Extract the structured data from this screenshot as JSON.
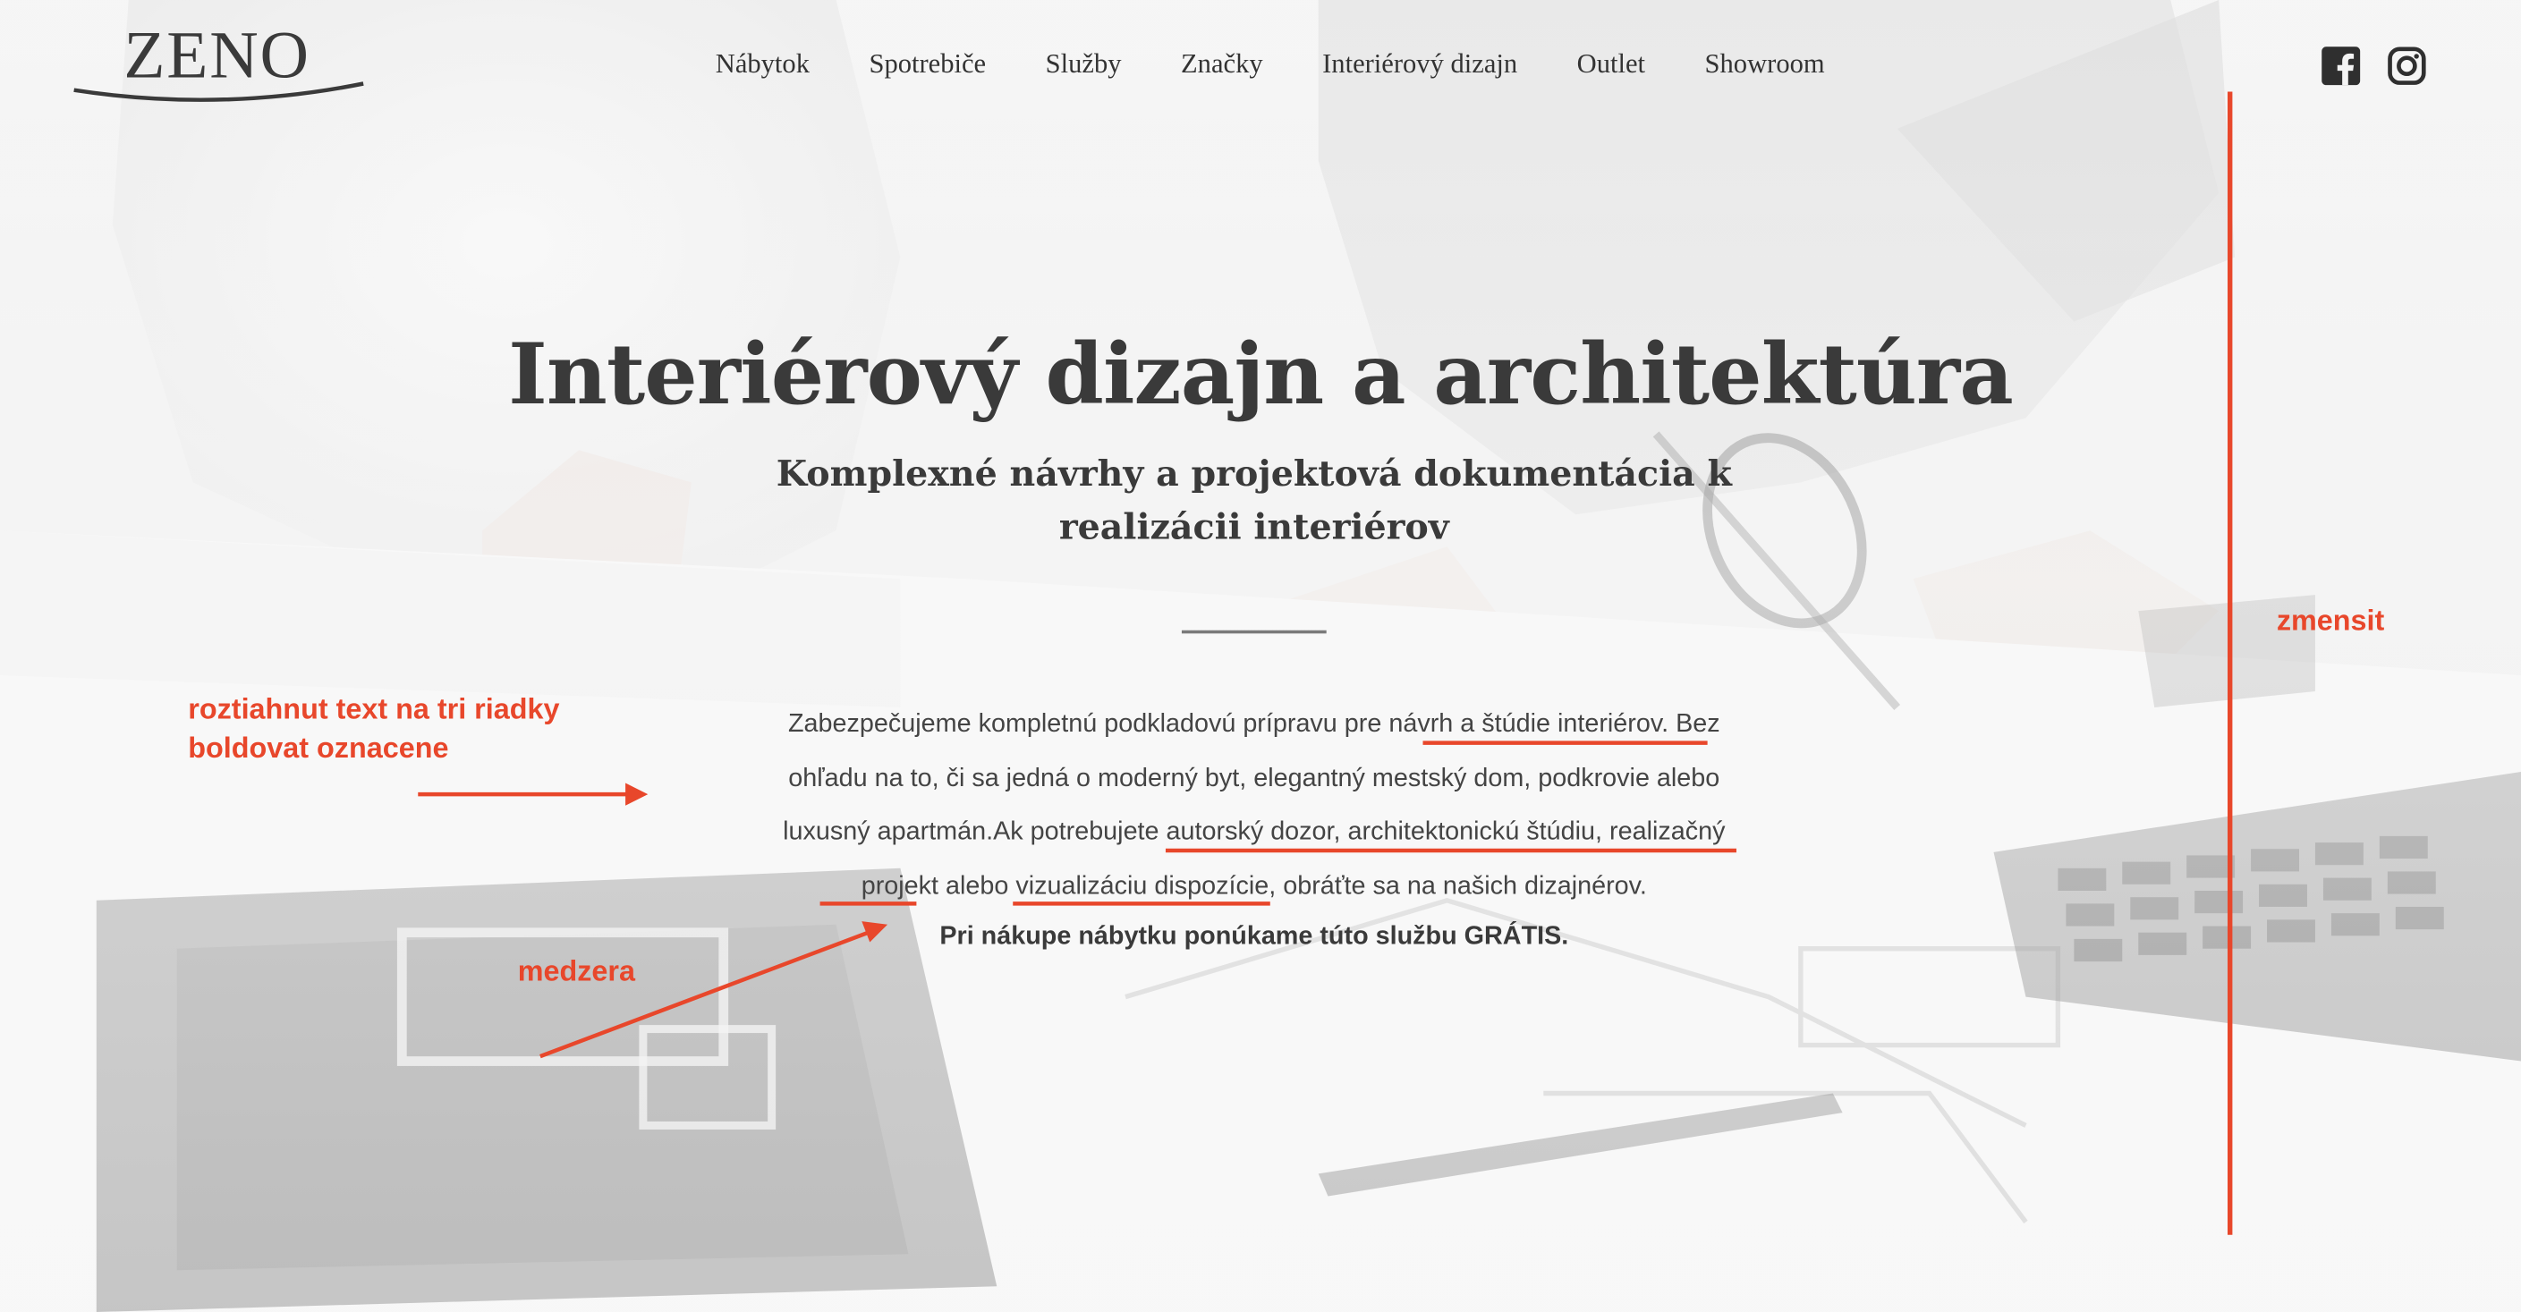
{
  "header": {
    "logo_text": "ZENO",
    "nav": [
      "Nábytok",
      "Spotrebiče",
      "Služby",
      "Značky",
      "Interiérový dizajn",
      "Outlet",
      "Showroom"
    ],
    "social_icons": [
      "facebook-icon",
      "instagram-icon"
    ]
  },
  "hero": {
    "title": "Interiérový dizajn a architektúra",
    "subtitle_line1": "Komplexné návrhy a projektová dokumentácia k",
    "subtitle_line2": "realizácii interiérov",
    "body_lines": [
      "Zabezpečujeme kompletnú podkladovú prípravu pre návrh a štúdie interiérov. Bez",
      "ohľadu na to, či sa jedná o moderný byt, elegantný mestský dom, podkrovie alebo",
      "luxusný apartmán.Ak potrebujete autorský dozor, architektonickú štúdiu, realizačný",
      "projekt alebo vizualizáciu dispozície, obráťte sa na našich dizajnérov."
    ],
    "body_bold": "Pri nákupe nábytku ponúkame túto službu GRÁTIS."
  },
  "annotations": {
    "left_line1": "roztiahnut text na tri riadky",
    "left_line2": "boldovat oznacene",
    "medzera": "medzera",
    "zmensit": "zmensit"
  },
  "colors": {
    "annotation_red": "#e8472b",
    "text_dark": "#3a3a3a"
  }
}
